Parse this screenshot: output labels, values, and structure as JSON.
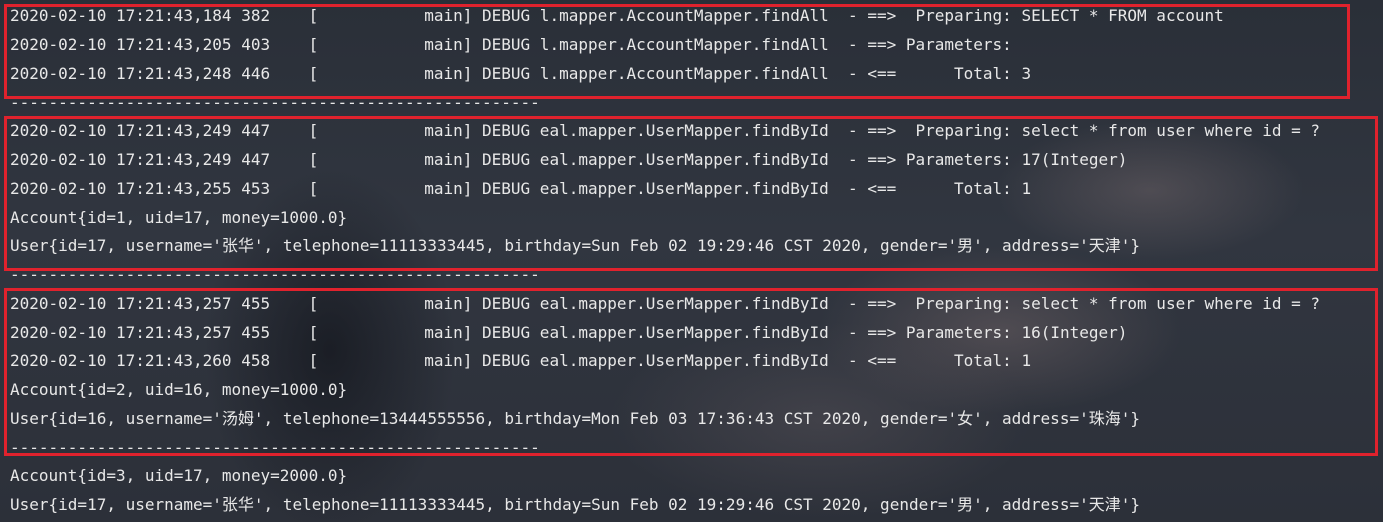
{
  "log_lines": [
    "2020-02-10 17:21:43,184 382    [           main] DEBUG l.mapper.AccountMapper.findAll  - ==>  Preparing: SELECT * FROM account",
    "2020-02-10 17:21:43,205 403    [           main] DEBUG l.mapper.AccountMapper.findAll  - ==> Parameters: ",
    "2020-02-10 17:21:43,248 446    [           main] DEBUG l.mapper.AccountMapper.findAll  - <==      Total: 3",
    "-------------------------------------------------------",
    "2020-02-10 17:21:43,249 447    [           main] DEBUG eal.mapper.UserMapper.findById  - ==>  Preparing: select * from user where id = ?",
    "2020-02-10 17:21:43,249 447    [           main] DEBUG eal.mapper.UserMapper.findById  - ==> Parameters: 17(Integer)",
    "2020-02-10 17:21:43,255 453    [           main] DEBUG eal.mapper.UserMapper.findById  - <==      Total: 1",
    "Account{id=1, uid=17, money=1000.0}",
    "User{id=17, username='张华', telephone=11113333445, birthday=Sun Feb 02 19:29:46 CST 2020, gender='男', address='天津'}",
    "-------------------------------------------------------",
    "2020-02-10 17:21:43,257 455    [           main] DEBUG eal.mapper.UserMapper.findById  - ==>  Preparing: select * from user where id = ?",
    "2020-02-10 17:21:43,257 455    [           main] DEBUG eal.mapper.UserMapper.findById  - ==> Parameters: 16(Integer)",
    "2020-02-10 17:21:43,260 458    [           main] DEBUG eal.mapper.UserMapper.findById  - <==      Total: 1",
    "Account{id=2, uid=16, money=1000.0}",
    "User{id=16, username='汤姆', telephone=13444555556, birthday=Mon Feb 03 17:36:43 CST 2020, gender='女', address='珠海'}",
    "-------------------------------------------------------",
    "Account{id=3, uid=17, money=2000.0}",
    "User{id=17, username='张华', telephone=11113333445, birthday=Sun Feb 02 19:29:46 CST 2020, gender='男', address='天津'}"
  ],
  "colors": {
    "text": "#e8e8e8",
    "highlight_border": "#e0222d",
    "background": "#2f343d"
  }
}
